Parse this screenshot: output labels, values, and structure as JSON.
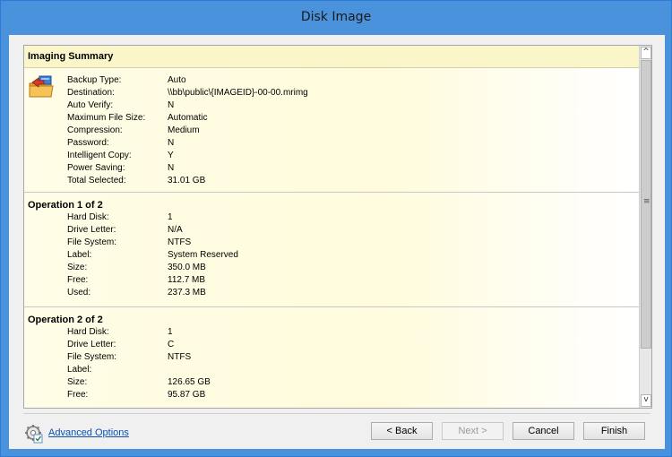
{
  "window": {
    "title": "Disk Image"
  },
  "summary": {
    "header": "Imaging Summary",
    "rows": [
      {
        "label": "Backup Type:",
        "value": "Auto"
      },
      {
        "label": "Destination:",
        "value": "\\\\bb\\public\\{IMAGEID}-00-00.mrimg"
      },
      {
        "label": "Auto Verify:",
        "value": "N"
      },
      {
        "label": "Maximum File Size:",
        "value": "Automatic"
      },
      {
        "label": "Compression:",
        "value": "Medium"
      },
      {
        "label": "Password:",
        "value": "N"
      },
      {
        "label": "Intelligent Copy:",
        "value": "Y"
      },
      {
        "label": "Power Saving:",
        "value": "N"
      },
      {
        "label": "Total Selected:",
        "value": "31.01 GB"
      }
    ]
  },
  "operations": [
    {
      "header": "Operation 1 of 2",
      "rows": [
        {
          "label": "Hard Disk:",
          "value": "1"
        },
        {
          "label": "Drive Letter:",
          "value": "N/A"
        },
        {
          "label": "File System:",
          "value": "NTFS"
        },
        {
          "label": "Label:",
          "value": "System Reserved"
        },
        {
          "label": "Size:",
          "value": "350.0 MB"
        },
        {
          "label": "Free:",
          "value": "112.7 MB"
        },
        {
          "label": "Used:",
          "value": "237.3 MB"
        }
      ]
    },
    {
      "header": "Operation 2 of 2",
      "rows": [
        {
          "label": "Hard Disk:",
          "value": "1"
        },
        {
          "label": "Drive Letter:",
          "value": "C"
        },
        {
          "label": "File System:",
          "value": "NTFS"
        },
        {
          "label": "Label:",
          "value": ""
        },
        {
          "label": "Size:",
          "value": "126.65 GB"
        },
        {
          "label": "Free:",
          "value": "95.87 GB"
        }
      ]
    }
  ],
  "footer": {
    "advanced_options": "Advanced Options",
    "back": "< Back",
    "next": "Next >",
    "cancel": "Cancel",
    "finish": "Finish"
  },
  "scrollbar": {
    "up_glyph": "^",
    "down_glyph": "v",
    "grip_glyph": "≡"
  },
  "icons": {
    "imaging": "imaging-drive-icon",
    "advanced": "advanced-options-icon"
  },
  "colors": {
    "title_bar": "#4a92dc",
    "summary_header": "#fbf6c9",
    "link": "#0b4fb3"
  }
}
